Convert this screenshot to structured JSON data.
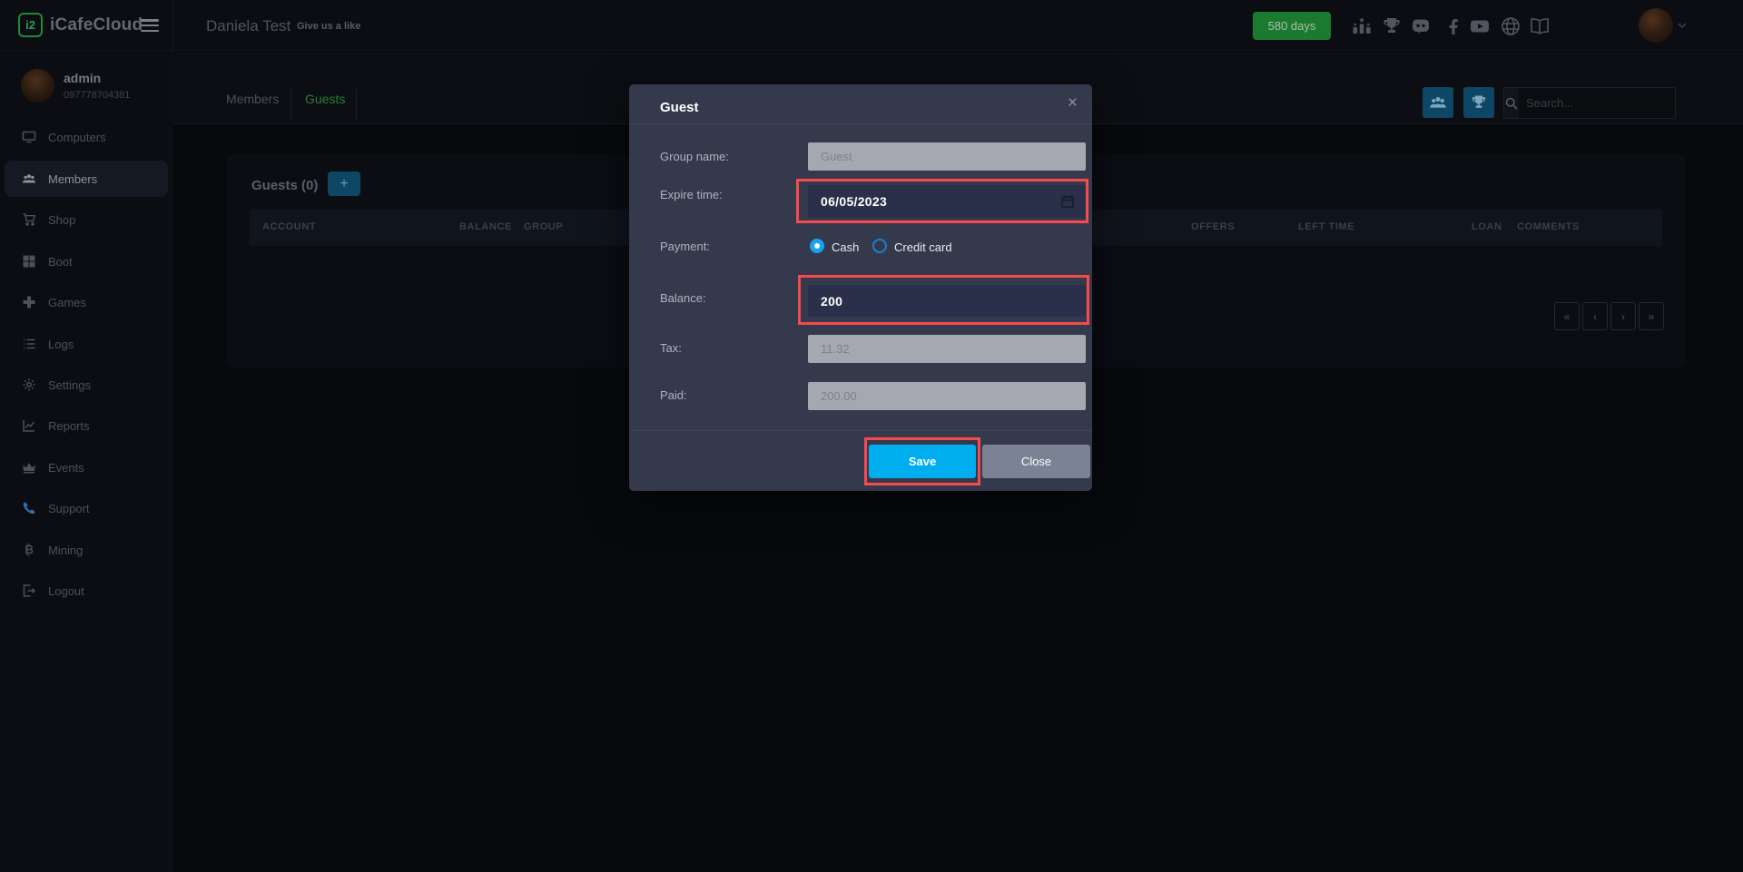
{
  "brand": {
    "name": "iCafeCloud",
    "logo_glyph": "i2"
  },
  "header": {
    "title": "Daniela Test",
    "like_label": "Give us a like",
    "days_badge": "580 days"
  },
  "sidebar": {
    "user": {
      "name": "admin",
      "phone": "097778704381"
    },
    "items": [
      {
        "label": "Computers"
      },
      {
        "label": "Members"
      },
      {
        "label": "Shop"
      },
      {
        "label": "Boot"
      },
      {
        "label": "Games"
      },
      {
        "label": "Logs"
      },
      {
        "label": "Settings"
      },
      {
        "label": "Reports"
      },
      {
        "label": "Events"
      },
      {
        "label": "Support"
      },
      {
        "label": "Mining"
      },
      {
        "label": "Logout"
      }
    ]
  },
  "content": {
    "tabs": [
      {
        "label": "Members"
      },
      {
        "label": "Guests"
      }
    ],
    "search": {
      "placeholder": "Search..."
    },
    "section": {
      "title": "Guests (0)",
      "add_label": "+"
    },
    "table": {
      "headers": [
        "ACCOUNT",
        "BALANCE",
        "GROUP",
        "OFFERS",
        "LEFT TIME",
        "LOAN",
        "COMMENTS"
      ]
    },
    "pagination": {
      "first": "«",
      "prev": "‹",
      "next": "›",
      "last": "»"
    }
  },
  "modal": {
    "title": "Guest",
    "close_x": "×",
    "group_name": {
      "label": "Group name:",
      "value": "Guest"
    },
    "expire_time": {
      "label": "Expire time:",
      "value": "06/05/2023"
    },
    "payment": {
      "label": "Payment:",
      "options": [
        {
          "label": "Cash",
          "selected": true
        },
        {
          "label": "Credit card",
          "selected": false
        }
      ]
    },
    "balance": {
      "label": "Balance:",
      "value": "200"
    },
    "tax": {
      "label": "Tax:",
      "value": "11.32"
    },
    "paid": {
      "label": "Paid:",
      "value": "200.00"
    },
    "buttons": {
      "save": "Save",
      "close": "Close"
    }
  },
  "colors": {
    "accent_blue": "#00aef0",
    "highlight_red": "#f8494e",
    "badge_green": "#1b7a2f",
    "active_tab_green": "#2e7c39",
    "teal_button": "#0d4765"
  }
}
